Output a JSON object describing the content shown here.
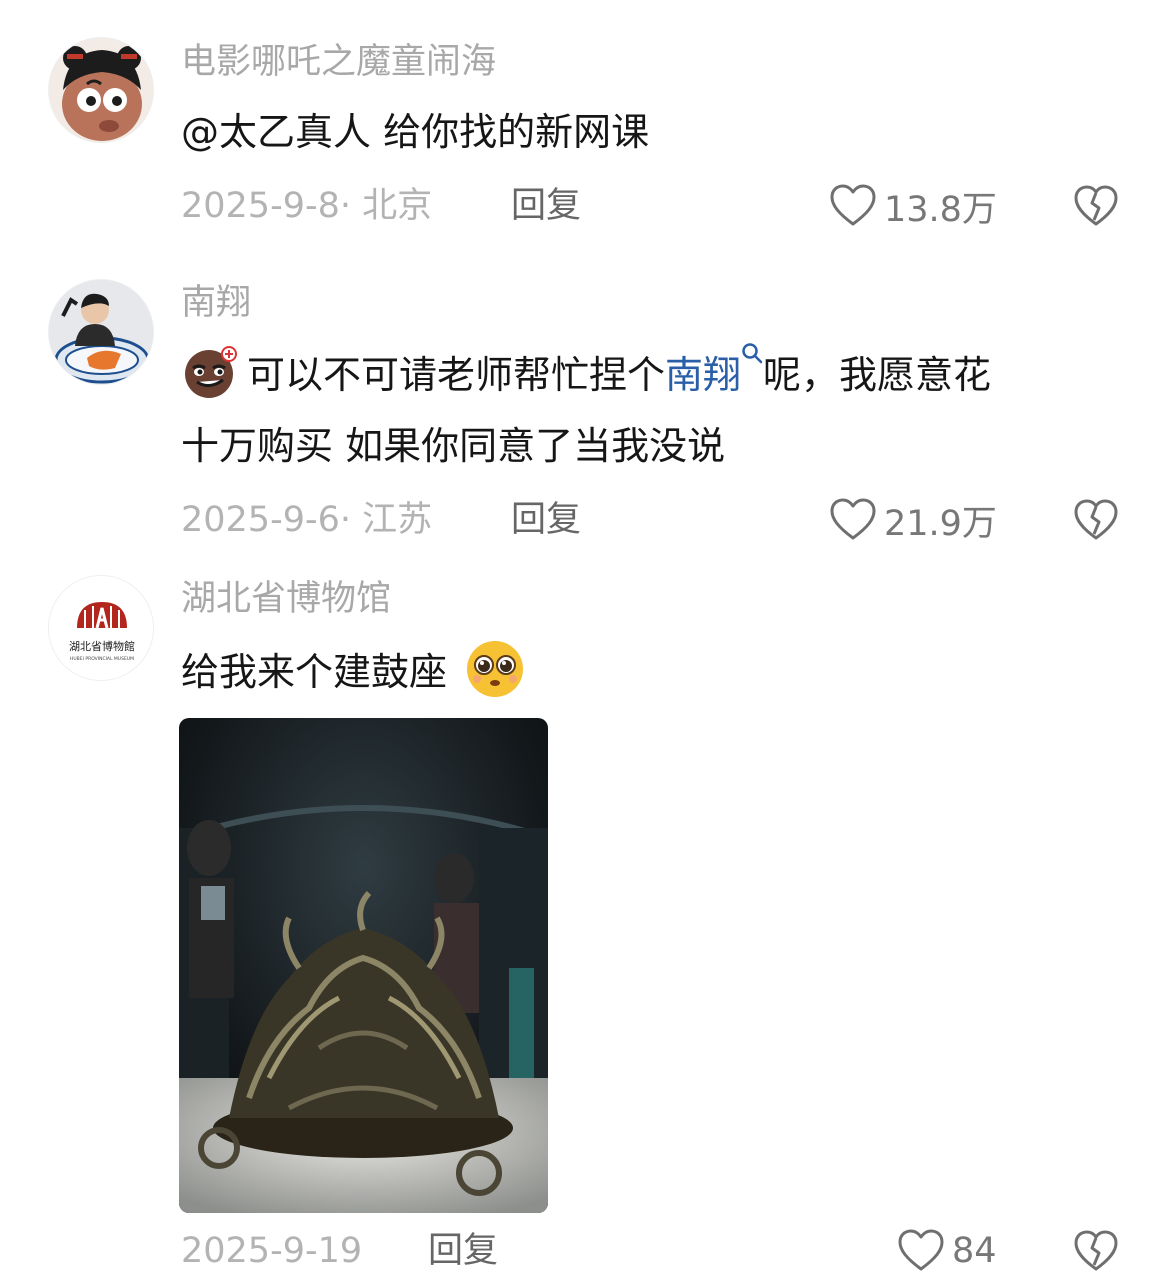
{
  "comments": [
    {
      "username": "电影哪吒之魔童闹海",
      "text_mention": "@太乙真人",
      "text_rest": " 给你找的新网课",
      "date": "2025-9-8",
      "location": "· 北京",
      "reply_label": "回复",
      "likes": "13.8万"
    },
    {
      "username": "南翔",
      "line1_prefix": "可以不可请老师帮忙捏个",
      "line1_keyword": "南翔",
      "line1_suffix": "呢，我愿意花",
      "line2": "十万购买 如果你同意了当我没说",
      "date": "2025-9-6",
      "location": "· 江苏",
      "reply_label": "回复",
      "likes": "21.9万"
    },
    {
      "username": "湖北省博物馆",
      "avatar_logo_text": "湖北省博物館",
      "avatar_logo_subtext": "HUBEI PROVINCIAL MUSEUM",
      "text": "给我来个建鼓座",
      "date": "2025-9-19",
      "reply_label": "回复",
      "likes": "84"
    }
  ],
  "icons": {
    "like": "heart-outline-icon",
    "dislike": "broken-heart-icon",
    "search": "search-icon",
    "emoji_smirk": "smirk-emoji-icon",
    "emoji_pleading": "pleading-emoji-icon"
  },
  "colors": {
    "username": "#a8a8a8",
    "text": "#161616",
    "meta": "#b3b3b3",
    "reply": "#666666",
    "keyword_link": "#2a5fa8"
  }
}
